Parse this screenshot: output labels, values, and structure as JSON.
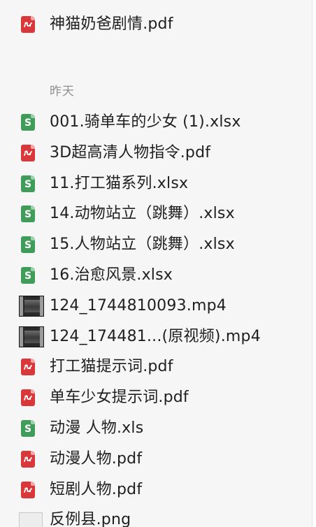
{
  "files_top": [
    {
      "name": "神猫奶爸剧情.pdf",
      "type": "pdf",
      "icon": "pdf-icon"
    }
  ],
  "group": {
    "label": "昨天"
  },
  "files": [
    {
      "name": "001.骑单车的少女 (1).xlsx",
      "type": "sheet",
      "icon": "spreadsheet-icon",
      "letter": "S"
    },
    {
      "name": "3D超高清人物指令.pdf",
      "type": "pdf",
      "icon": "pdf-icon"
    },
    {
      "name": "11.打工猫系列.xlsx",
      "type": "sheet",
      "icon": "spreadsheet-icon",
      "letter": "S"
    },
    {
      "name": "14.动物站立（跳舞）.xlsx",
      "type": "sheet",
      "icon": "spreadsheet-icon",
      "letter": "S"
    },
    {
      "name": "15.人物站立（跳舞）.xlsx",
      "type": "sheet",
      "icon": "spreadsheet-icon",
      "letter": "S"
    },
    {
      "name": "16.治愈风景.xlsx",
      "type": "sheet",
      "icon": "spreadsheet-icon",
      "letter": "S"
    },
    {
      "name": "124_1744810093.mp4",
      "type": "video",
      "icon": "video-thumbnail-icon"
    },
    {
      "name": "124_174481...(原视频).mp4",
      "type": "video",
      "icon": "video-thumbnail-icon"
    },
    {
      "name": "打工猫提示词.pdf",
      "type": "pdf",
      "icon": "pdf-icon"
    },
    {
      "name": "单车少女提示词.pdf",
      "type": "pdf",
      "icon": "pdf-icon"
    },
    {
      "name": "动漫 人物.xls",
      "type": "sheet",
      "icon": "spreadsheet-icon",
      "letter": "S"
    },
    {
      "name": "动漫人物.pdf",
      "type": "pdf",
      "icon": "pdf-icon"
    },
    {
      "name": "短剧人物.pdf",
      "type": "pdf",
      "icon": "pdf-icon"
    },
    {
      "name": "反例县.png",
      "type": "png",
      "icon": "image-thumbnail-icon"
    }
  ],
  "colors": {
    "pdf": "#d8383a",
    "sheet": "#3f9d59",
    "label": "#8f8f8f",
    "text": "#1f1f1f"
  }
}
